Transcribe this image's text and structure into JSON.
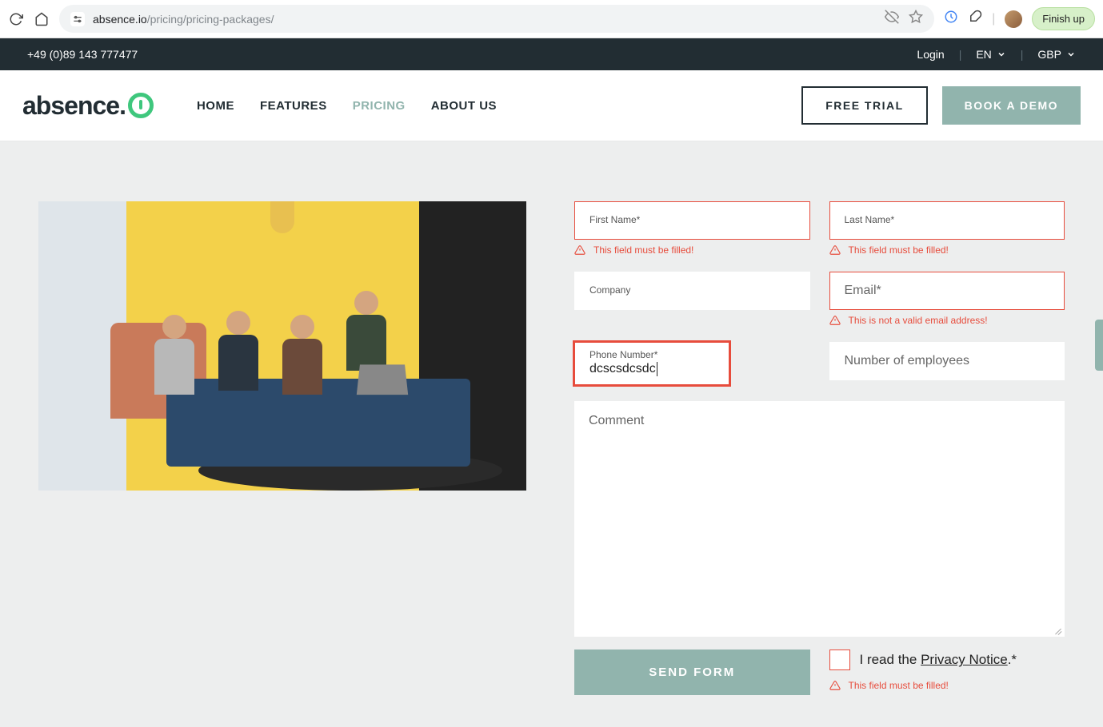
{
  "browser": {
    "url_host": "absence.io",
    "url_path": "/pricing/pricing-packages/",
    "finish_label": "Finish up"
  },
  "topbar": {
    "phone": "+49 (0)89 143 777477",
    "login": "Login",
    "lang": "EN",
    "currency": "GBP"
  },
  "nav": {
    "logo_text": "absence.",
    "home": "HOME",
    "features": "FEATURES",
    "pricing": "PRICING",
    "about": "ABOUT US",
    "free_trial": "FREE TRIAL",
    "book_demo": "BOOK A DEMO"
  },
  "form": {
    "first_name_label": "First Name*",
    "last_name_label": "Last Name*",
    "company_label": "Company",
    "email_label": "Email*",
    "phone_label": "Phone Number*",
    "phone_value": "dcscsdcsdc",
    "employees_placeholder": "Number of employees",
    "comment_placeholder": "Comment",
    "send_label": "SEND FORM",
    "privacy_prefix": "I read the ",
    "privacy_link": "Privacy Notice",
    "privacy_suffix": ".*",
    "err_required": "This field must be filled!",
    "err_email": "This is not a valid email address!"
  }
}
